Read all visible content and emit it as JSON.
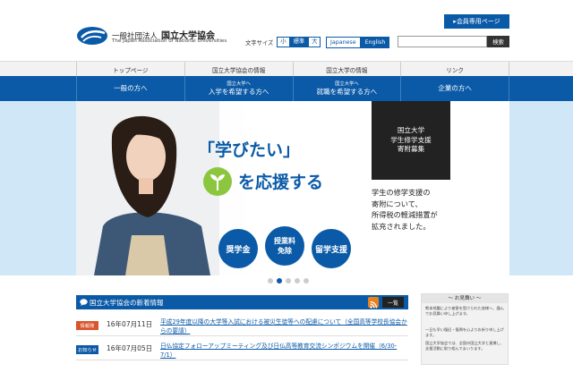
{
  "header": {
    "member_button": "会員専用ページ",
    "org_type": "一般社団法人",
    "org_name": "国立大学協会",
    "org_name_en": "The Japan Association of National Universities",
    "font_size_label": "文字サイズ",
    "font_sizes": [
      "小",
      "標準",
      "大"
    ],
    "lang_ja": "Japanese",
    "lang_en": "English",
    "search_placeholder": "",
    "search_button": "検索"
  },
  "top_nav": [
    "トップページ",
    "国立大学協会の情報",
    "国立大学の情報",
    "リンク"
  ],
  "blue_nav": [
    {
      "small": "",
      "main": "一般の方へ"
    },
    {
      "small": "国立大学へ",
      "main": "入学を希望する方へ"
    },
    {
      "small": "国立大学へ",
      "main": "就職を希望する方へ"
    },
    {
      "small": "",
      "main": "企業の方へ"
    }
  ],
  "hero": {
    "headline1": "「学びたい」",
    "headline2": "を応援する",
    "circle1": "奨学金",
    "circle2_line1": "授業料",
    "circle2_line2": "免除",
    "circle3": "留学支援",
    "fund_box": [
      "国立大学",
      "学生修学支援",
      "寄附募集"
    ],
    "fund_text": [
      "学生の修学支援の",
      "寄附について、",
      "所得税の軽減措置が",
      "拡充されました。"
    ],
    "slide_count": 5,
    "active_slide": 2
  },
  "news": {
    "title": "国立大学協会の新着情報",
    "list_button": "一覧",
    "items": [
      {
        "badge": "情報発",
        "date": "16年07月11日",
        "title": "平成29年度以降の大学等入試における被災生徒等への配慮について（全国高等学校長協会からの要請）"
      },
      {
        "badge": "お知らせ",
        "date": "16年07月05日",
        "title": "日仏協定フォローアップミーティング及び日仏高等教育交流シンポジウムを開催（6/30-7/1）"
      }
    ]
  },
  "side": {
    "title": "～ お見舞い ～",
    "p1": "熊本地震により被害を受けられた皆様へ、謹んでお見舞い申し上げます。",
    "p2": "一日も早い復旧・復興を心よりお祈り申し上げます。",
    "p3": "国立大学協会では、全国の国立大学と連携し、支援活動に取り組んでまいります。"
  }
}
